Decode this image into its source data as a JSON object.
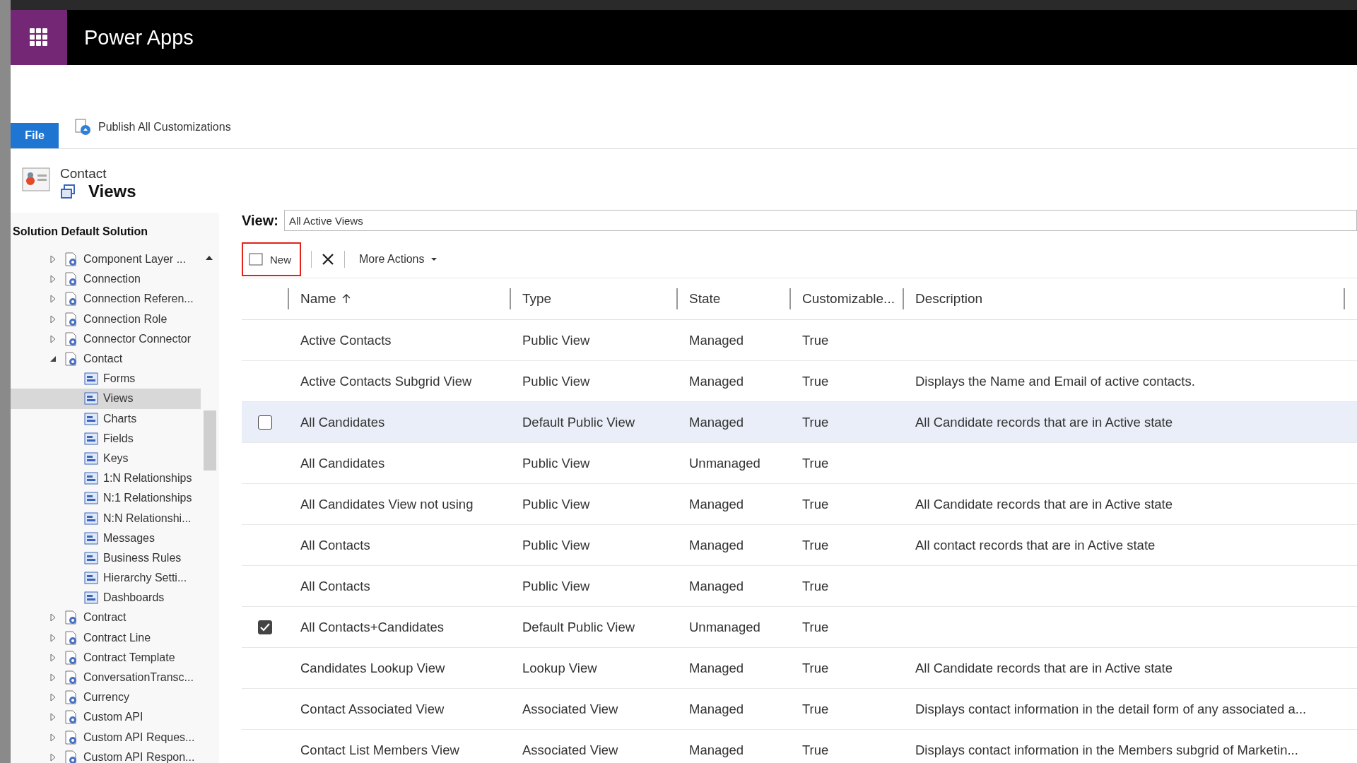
{
  "app": {
    "title": "Power Apps"
  },
  "ribbon": {
    "file_tab": "File",
    "action": "Publish All Customizations"
  },
  "breadcrumb": {
    "entity": "Contact",
    "page": "Views"
  },
  "solution": "Solution Default Solution",
  "tree": [
    {
      "label": "Component Layer ...",
      "expanded": false,
      "selected": false
    },
    {
      "label": "Connection",
      "expanded": false,
      "selected": false
    },
    {
      "label": "Connection Referen...",
      "expanded": false,
      "selected": false
    },
    {
      "label": "Connection Role",
      "expanded": false,
      "selected": false
    },
    {
      "label": "Connector Connector",
      "expanded": false,
      "selected": false
    },
    {
      "label": "Contact",
      "expanded": true,
      "selected": false,
      "children": [
        {
          "label": "Forms",
          "selected": false
        },
        {
          "label": "Views",
          "selected": true
        },
        {
          "label": "Charts",
          "selected": false
        },
        {
          "label": "Fields",
          "selected": false
        },
        {
          "label": "Keys",
          "selected": false
        },
        {
          "label": "1:N Relationships",
          "selected": false
        },
        {
          "label": "N:1 Relationships",
          "selected": false
        },
        {
          "label": "N:N Relationshi...",
          "selected": false
        },
        {
          "label": "Messages",
          "selected": false
        },
        {
          "label": "Business Rules",
          "selected": false
        },
        {
          "label": "Hierarchy Setti...",
          "selected": false
        },
        {
          "label": "Dashboards",
          "selected": false
        }
      ]
    },
    {
      "label": "Contract",
      "expanded": false,
      "selected": false
    },
    {
      "label": "Contract Line",
      "expanded": false,
      "selected": false
    },
    {
      "label": "Contract Template",
      "expanded": false,
      "selected": false
    },
    {
      "label": "ConversationTransc...",
      "expanded": false,
      "selected": false
    },
    {
      "label": "Currency",
      "expanded": false,
      "selected": false
    },
    {
      "label": "Custom API",
      "expanded": false,
      "selected": false
    },
    {
      "label": "Custom API Reques...",
      "expanded": false,
      "selected": false
    },
    {
      "label": "Custom API Respon...",
      "expanded": false,
      "selected": false
    }
  ],
  "view_selector": {
    "label": "View:",
    "value": "All Active Views"
  },
  "toolbar": {
    "new": "New",
    "more_actions": "More Actions"
  },
  "table": {
    "columns": [
      {
        "label": "Name",
        "sorted": true
      },
      {
        "label": "Type",
        "sorted": false
      },
      {
        "label": "State",
        "sorted": false
      },
      {
        "label": "Customizable...",
        "sorted": false
      },
      {
        "label": "Description",
        "sorted": false
      }
    ],
    "rows": [
      {
        "name": "Active Contacts",
        "type": "Public View",
        "state": "Managed",
        "customizable": "True",
        "selected": false,
        "hovered": false
      },
      {
        "name": "Active Contacts Subgrid View",
        "type": "Public View",
        "state": "Managed",
        "customizable": "True",
        "description": "Displays the Name and Email of active contacts.",
        "selected": false,
        "hovered": false
      },
      {
        "name": "All Candidates",
        "type": "Default Public View",
        "state": "Managed",
        "customizable": "True",
        "description": "All Candidate records that are in Active state",
        "selected": false,
        "hovered": true
      },
      {
        "name": "All Candidates",
        "type": "Public View",
        "state": "Unmanaged",
        "customizable": "True",
        "selected": false,
        "hovered": false
      },
      {
        "name": "All Candidates View not using",
        "type": "Public View",
        "state": "Managed",
        "customizable": "True",
        "description": "All Candidate records that are in Active state",
        "selected": false,
        "hovered": false
      },
      {
        "name": "All Contacts",
        "type": "Public View",
        "state": "Managed",
        "customizable": "True",
        "description": "All contact records that are in Active state",
        "selected": false,
        "hovered": false
      },
      {
        "name": "All Contacts",
        "type": "Public View",
        "state": "Managed",
        "customizable": "True",
        "selected": false,
        "hovered": false
      },
      {
        "name": "All Contacts+Candidates",
        "type": "Default Public View",
        "state": "Unmanaged",
        "customizable": "True",
        "selected": true,
        "hovered": false
      },
      {
        "name": "Candidates Lookup View",
        "type": "Lookup View",
        "state": "Managed",
        "customizable": "True",
        "description": "All Candidate records that are in Active state",
        "selected": false,
        "hovered": false
      },
      {
        "name": "Contact Associated View",
        "type": "Associated View",
        "state": "Managed",
        "customizable": "True",
        "description": "Displays contact information in the detail form of any associated a...",
        "selected": false,
        "hovered": false
      },
      {
        "name": "Contact List Members View",
        "type": "Associated View",
        "state": "Managed",
        "customizable": "True",
        "description": "Displays contact information in the Members subgrid of Marketin...",
        "selected": false,
        "hovered": false
      }
    ]
  }
}
